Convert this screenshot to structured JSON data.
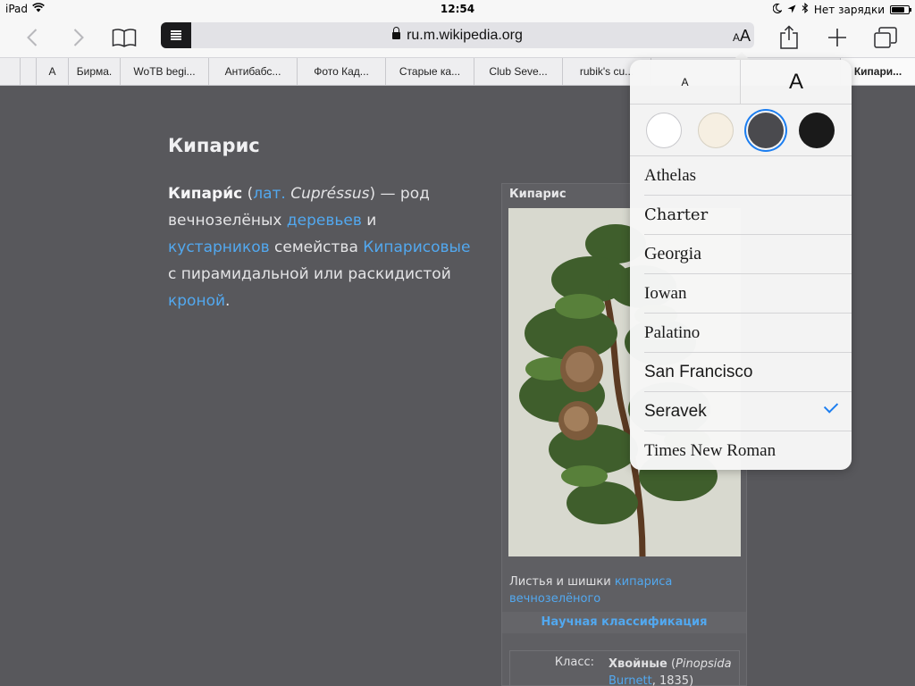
{
  "status_bar": {
    "device": "iPad",
    "time": "12:54",
    "charging_text": "Нет зарядки"
  },
  "toolbar": {
    "url": "ru.m.wikipedia.org",
    "aa_small": "A",
    "aa_big": "A"
  },
  "bookmarks": [
    {
      "label": "А"
    },
    {
      "label": "Бирма."
    },
    {
      "label": "WoTB begi..."
    },
    {
      "label": "Антибабс..."
    },
    {
      "label": "Фото Кад..."
    },
    {
      "label": "Старые ка..."
    },
    {
      "label": "Club Seve..."
    },
    {
      "label": "rubik's cu..."
    },
    {
      "label": ""
    },
    {
      "label": "Кипари..."
    }
  ],
  "article": {
    "title": "Кипарис",
    "body": {
      "term": "Кипари́с",
      "open_paren": " (",
      "lat": "лат.",
      "latin_name": " Cupréssus",
      "p1": ") — род вечнозелёных ",
      "trees": "деревьев",
      "and": " и ",
      "shrubs": "кустарников",
      "p2": " семейства ",
      "family": "Кипарисовые",
      "p3": " с пирамидальной или раскидистой ",
      "crown": "кроной",
      "end": "."
    },
    "infobox": {
      "title": "Кипарис",
      "photo_caption_text": "Листья и шишки ",
      "photo_caption_link1": "кипариса",
      "photo_caption_link2": "вечнозелёного",
      "classification": "Научная классификация",
      "class_label": "Класс:",
      "class_value": "Хвойные",
      "class_latin_open": " (",
      "class_latin": "Pinopsida",
      "class_author": "Burnett",
      "class_year": ", 1835)"
    }
  },
  "reader_popover": {
    "size_small": "A",
    "size_big": "A",
    "themes": [
      {
        "name": "white",
        "color": "#ffffff",
        "selected": false
      },
      {
        "name": "sepia",
        "color": "#f6efe2",
        "selected": false
      },
      {
        "name": "gray",
        "color": "#4a4a4e",
        "selected": true
      },
      {
        "name": "night",
        "color": "#1a1a1a",
        "selected": false
      }
    ],
    "fonts": [
      {
        "label": "Athelas",
        "selected": false
      },
      {
        "label": "Charter",
        "selected": false
      },
      {
        "label": "Georgia",
        "selected": false
      },
      {
        "label": "Iowan",
        "selected": false
      },
      {
        "label": "Palatino",
        "selected": false
      },
      {
        "label": "San Francisco",
        "selected": false
      },
      {
        "label": "Seravek",
        "selected": true
      },
      {
        "label": "Times New Roman",
        "selected": false
      }
    ]
  }
}
